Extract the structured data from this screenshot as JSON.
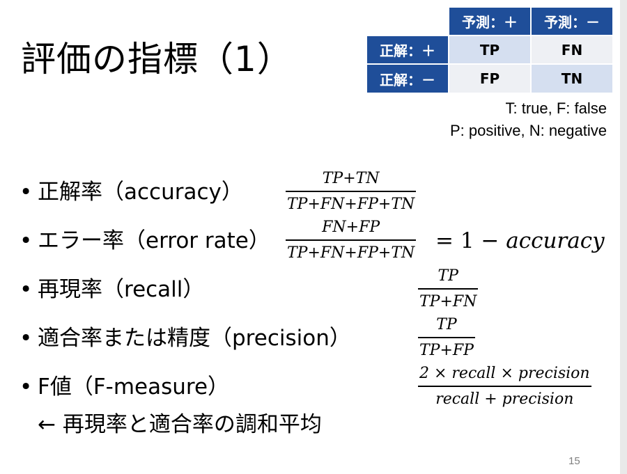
{
  "title": "評価の指標（1）",
  "confusion_table": {
    "col_headers": [
      "予測：＋",
      "予測：－"
    ],
    "row_headers": [
      "正解：＋",
      "正解：－"
    ],
    "cells": [
      [
        "TP",
        "FN"
      ],
      [
        "FP",
        "TN"
      ]
    ]
  },
  "legend": {
    "line1": "T: true, F: false",
    "line2": "P: positive, N: negative"
  },
  "bullets": {
    "dot": "•",
    "accuracy": "正解率（accuracy）",
    "error_rate": "エラー率（error rate）",
    "recall": "再現率（recall）",
    "precision": "適合率または精度（precision）",
    "f_measure": "F値（F-measure）",
    "f_measure_note": "← 再現率と適合率の調和平均"
  },
  "formulas": {
    "accuracy": {
      "num": "TP+TN",
      "den": "TP+FN+FP+TN"
    },
    "error_rate": {
      "num": "FN+FP",
      "den": "TP+FN+FP+TN",
      "rhs_prefix": "= 1 − ",
      "rhs_var": "accuracy"
    },
    "recall": {
      "num": "TP",
      "den": "TP+FN"
    },
    "precision": {
      "num": "TP",
      "den": "TP+FP"
    },
    "f_measure": {
      "num": "2 × recall × precision",
      "den": "recall + precision"
    }
  },
  "page_number": "15"
}
